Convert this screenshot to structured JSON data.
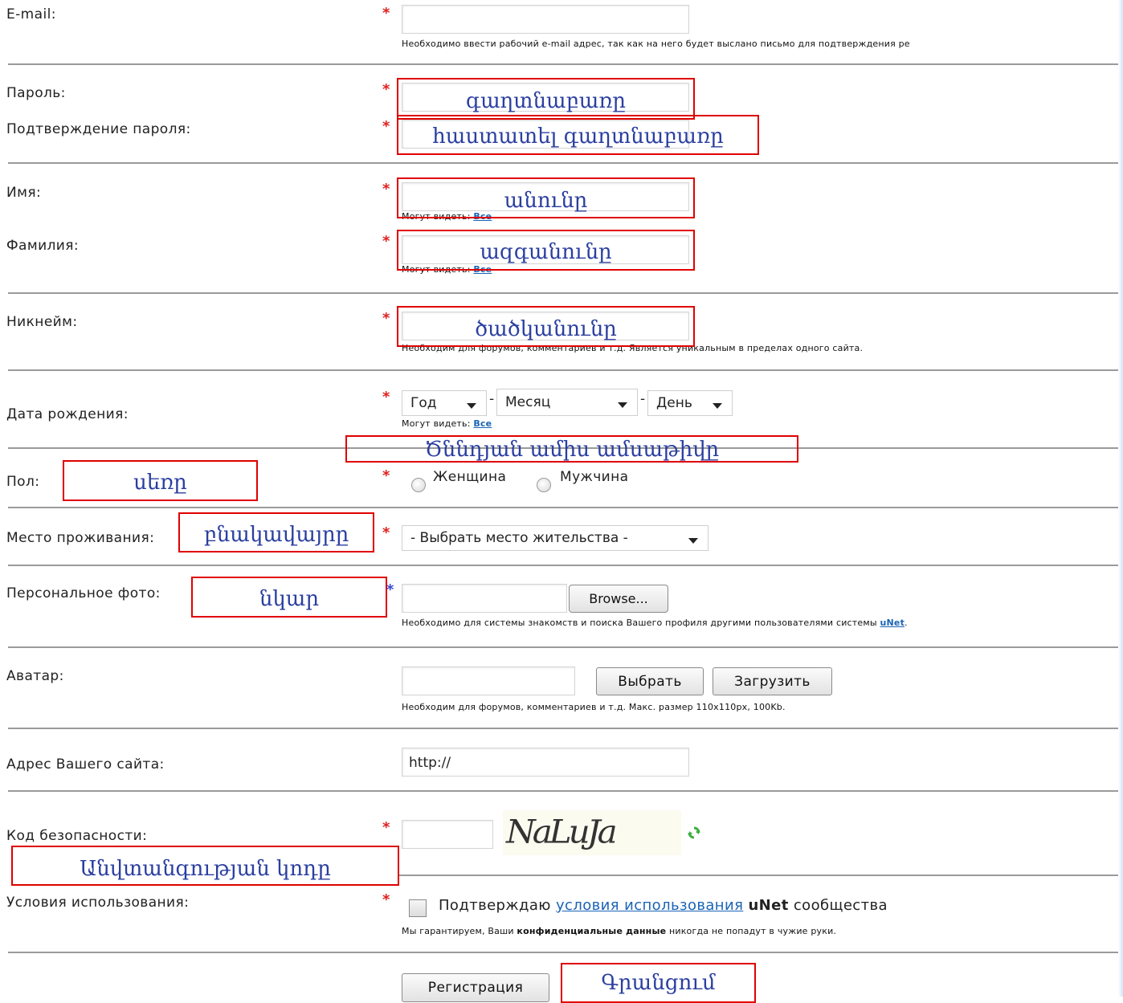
{
  "fields": {
    "email": {
      "label": "E-mail:",
      "value": "",
      "hint": "Необходимо ввести рабочий e-mail адрес, так как на него будет выслано письмо для подтверждения ре"
    },
    "password": {
      "label": "Пароль:",
      "annotation": "գաղտնաբառը"
    },
    "password_confirm": {
      "label": "Подтверждение пароля:",
      "annotation": "հաստատել գաղտնաբառը"
    },
    "first_name": {
      "label": "Имя:",
      "annotation": "անունը",
      "visibility_prefix": "Могут видеть:",
      "visibility_link": "Все"
    },
    "last_name": {
      "label": "Фамилия:",
      "annotation": "ազգանունը",
      "visibility_prefix": "Могут видеть:",
      "visibility_link": "Все"
    },
    "nickname": {
      "label": "Никнейм:",
      "annotation": "ծածկանունը",
      "hint": "Необходим для форумов, комментариев и т.д. Является уникальным в пределах одного сайта."
    },
    "birthdate": {
      "label": "Дата рождения:",
      "year": "Год",
      "month": "Месяц",
      "day": "День",
      "separator": "-",
      "visibility_prefix": "Могут видеть:",
      "visibility_link": "Все",
      "annotation": "Ծննդյան ամիս ամսաթիվը"
    },
    "gender": {
      "label": "Пол:",
      "annotation": "սեռը",
      "option_female": "Женщина",
      "option_male": "Мужчина"
    },
    "residence": {
      "label": "Место проживания:",
      "annotation": "բնակավայրը",
      "select_value": "- Выбрать место жительства -"
    },
    "photo": {
      "label": "Персональное фото:",
      "annotation": "նկար",
      "browse_label": "Browse...",
      "hint_prefix": "Необходимо для системы знакомств и поиска Вашего профиля другими пользователями системы",
      "hint_link": "uNet",
      "hint_suffix": "."
    },
    "avatar": {
      "label": "Аватар:",
      "choose_label": "Выбрать",
      "upload_label": "Загрузить",
      "hint": "Необходим для форумов, комментариев и т.д. Макс. размер 110x110px, 100Kb."
    },
    "website": {
      "label": "Адрес Вашего сайта:",
      "value": "http://"
    },
    "captcha": {
      "label": "Код безопасности:",
      "image_text": "NaLuJa",
      "annotation": "Անվտանգության կոդը"
    },
    "terms": {
      "label": "Условия использования:",
      "text_prefix": "Подтверждаю",
      "link": "условия использования",
      "brand": "uNet",
      "text_suffix": "сообщества",
      "note_prefix": "Мы гарантируем, Ваши",
      "note_bold": "конфиденциальные данные",
      "note_suffix": "никогда не попадут в чужие руки."
    }
  },
  "submit": {
    "label": "Регистрация",
    "annotation": "Գրանցում"
  },
  "required_mark": "*",
  "colors": {
    "annotation_border": "#e00000",
    "annotation_text": "#2b3fa0",
    "required": "#e02020",
    "link": "#1a63b5"
  },
  "icons": {
    "refresh": "refresh-icon",
    "dropdown": "chevron-down-icon"
  }
}
